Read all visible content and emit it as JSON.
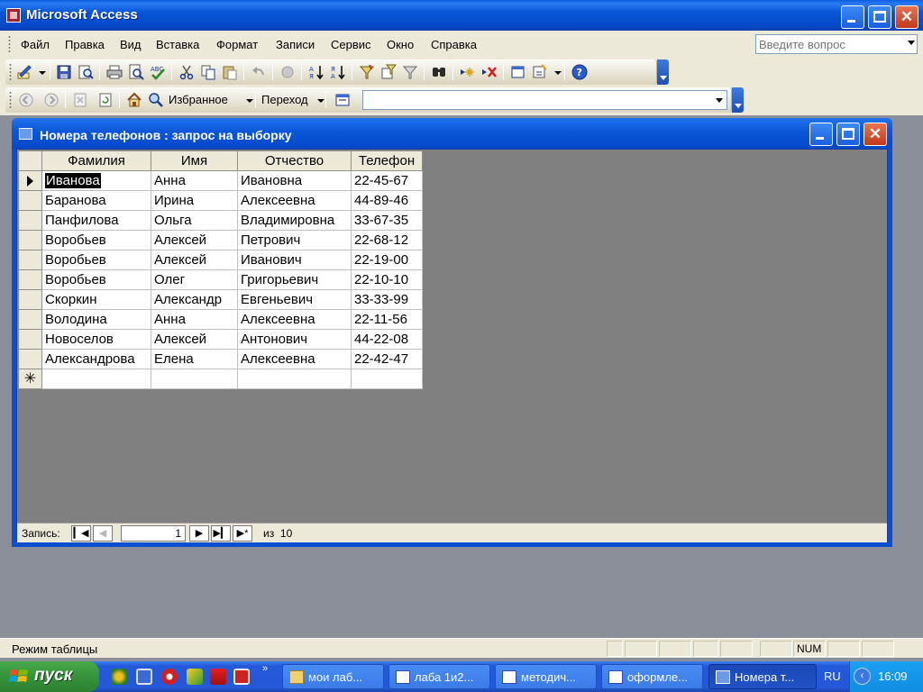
{
  "app": {
    "title": "Microsoft Access"
  },
  "menu": {
    "items": [
      "Файл",
      "Правка",
      "Вид",
      "Вставка",
      "Формат",
      "Записи",
      "Сервис",
      "Окно",
      "Справка"
    ],
    "help_placeholder": "Введите вопрос"
  },
  "web_toolbar": {
    "favorites_label": "Избранное",
    "goto_label": "Переход"
  },
  "child": {
    "title": "Номера телефонов : запрос на выборку",
    "columns": [
      "Фамилия",
      "Имя",
      "Отчество",
      "Телефон"
    ],
    "rows": [
      [
        "Иванова",
        "Анна",
        "Ивановна",
        "22-45-67"
      ],
      [
        "Баранова",
        "Ирина",
        "Алексеевна",
        "44-89-46"
      ],
      [
        "Панфилова",
        "Ольга",
        "Владимировна",
        "33-67-35"
      ],
      [
        "Воробьев",
        "Алексей",
        "Петрович",
        "22-68-12"
      ],
      [
        "Воробьев",
        "Алексей",
        "Иванович",
        "22-19-00"
      ],
      [
        "Воробьев",
        "Олег",
        "Григорьевич",
        "22-10-10"
      ],
      [
        "Скоркин",
        "Александр",
        "Евгеньевич",
        "33-33-99"
      ],
      [
        "Володина",
        "Анна",
        "Алексеевна",
        "22-11-56"
      ],
      [
        "Новоселов",
        "Алексей",
        "Антонович",
        "44-22-08"
      ],
      [
        "Александрова",
        "Елена",
        "Алексеевна",
        "22-42-47"
      ]
    ],
    "record_nav": {
      "label": "Запись:",
      "current": "1",
      "of_label": "из",
      "total": "10"
    }
  },
  "status": {
    "mode": "Режим таблицы",
    "num": "NUM"
  },
  "taskbar": {
    "start_label": "пуск",
    "buttons": [
      "мои лаб...",
      "лаба 1и2...",
      "методич...",
      "оформле...",
      "Номера т..."
    ],
    "lang": "RU",
    "clock": "16:09"
  }
}
